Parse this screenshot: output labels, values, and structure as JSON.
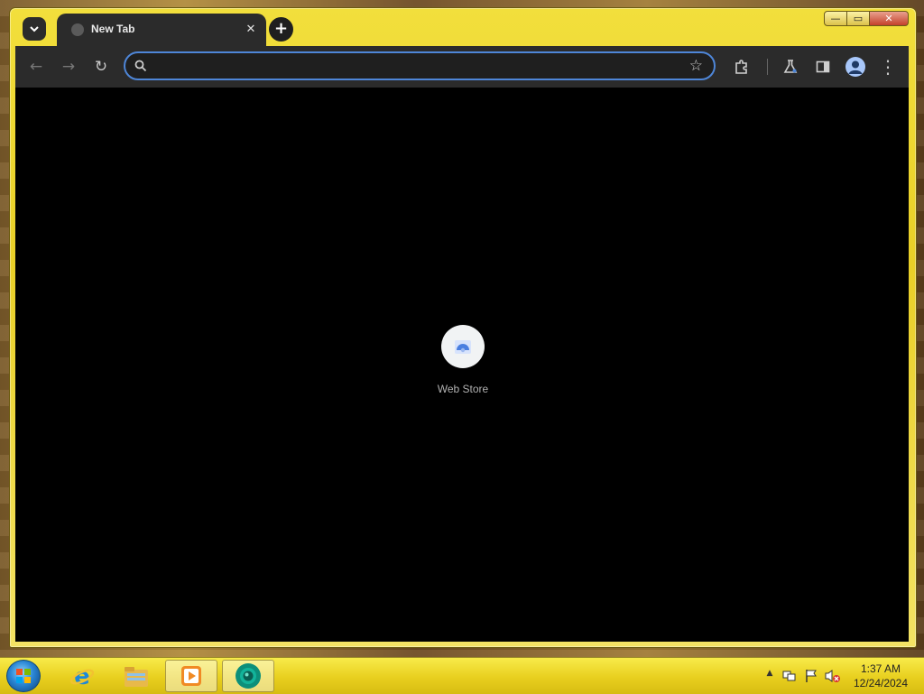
{
  "window": {
    "caption_buttons": {
      "minimize": "—",
      "maximize": "▭",
      "close": "✕"
    }
  },
  "tabs": [
    {
      "title": "New Tab",
      "favicon": "globe-icon",
      "close": "✕"
    }
  ],
  "tabstrip": {
    "new_tab": "+",
    "tab_search": "chevron-down-icon"
  },
  "toolbar": {
    "back": "←",
    "forward": "→",
    "reload": "↻",
    "omnibox": {
      "value": "",
      "placeholder": ""
    },
    "bookmark_star": "☆",
    "extensions": "puzzle-icon",
    "labs": "flask-icon",
    "side_panel": "side-panel-icon",
    "profile": "avatar-icon",
    "menu": "⋮"
  },
  "content": {
    "background": "#000000",
    "shortcuts": [
      {
        "label": "Web Store",
        "icon": "web-store-icon"
      }
    ]
  },
  "taskbar": {
    "start": "windows-start-icon",
    "pinned": [
      {
        "name": "internet-explorer-icon"
      },
      {
        "name": "file-explorer-icon"
      },
      {
        "name": "media-player-icon"
      },
      {
        "name": "chrome-icon",
        "active": true
      }
    ],
    "tray": {
      "show_hidden": "▲",
      "network": "network-icon",
      "flag": "action-center-icon",
      "volume": "volume-muted-icon"
    },
    "clock": {
      "time": "1:37 AM",
      "date": "12/24/2024"
    }
  },
  "colors": {
    "accent": "#4e86d8",
    "frame": "#e9cf27",
    "toolbar": "#2b2b2b"
  }
}
